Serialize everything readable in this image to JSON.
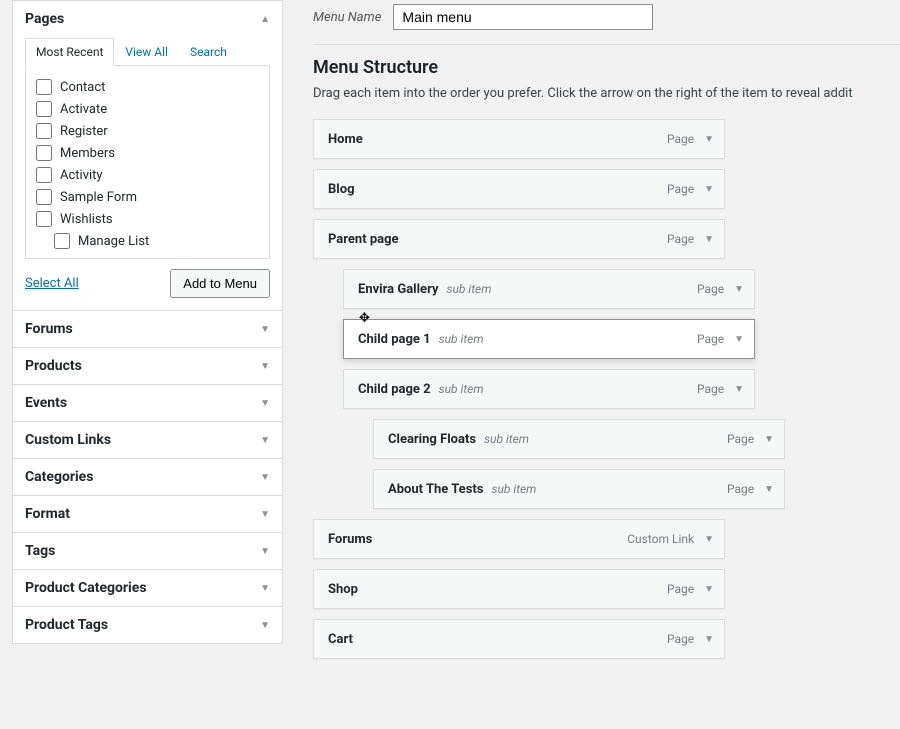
{
  "menuNameLabel": "Menu Name",
  "menuNameValue": "Main menu",
  "structureHeading": "Menu Structure",
  "structureHelp": "Drag each item into the order you prefer. Click the arrow on the right of the item to reveal addit",
  "subItemLabel": "sub item",
  "selectAll": "Select All",
  "addToMenu": "Add to Menu",
  "sidebar": {
    "pagesTitle": "Pages",
    "tabs": {
      "recent": "Most Recent",
      "viewAll": "View All",
      "search": "Search"
    },
    "pageList": [
      {
        "label": "Contact",
        "indent": false
      },
      {
        "label": "Activate",
        "indent": false
      },
      {
        "label": "Register",
        "indent": false
      },
      {
        "label": "Members",
        "indent": false
      },
      {
        "label": "Activity",
        "indent": false
      },
      {
        "label": "Sample Form",
        "indent": false
      },
      {
        "label": "Wishlists",
        "indent": false
      },
      {
        "label": "Manage List",
        "indent": true
      }
    ],
    "collapsedBoxes": [
      "Forums",
      "Products",
      "Events",
      "Custom Links",
      "Categories",
      "Format",
      "Tags",
      "Product Categories",
      "Product Tags"
    ]
  },
  "menuItems": [
    {
      "title": "Home",
      "type": "Page",
      "indent": 0,
      "sub": false,
      "drag": false
    },
    {
      "title": "Blog",
      "type": "Page",
      "indent": 0,
      "sub": false,
      "drag": false
    },
    {
      "title": "Parent page",
      "type": "Page",
      "indent": 0,
      "sub": false,
      "drag": false
    },
    {
      "title": "Envira Gallery",
      "type": "Page",
      "indent": 1,
      "sub": true,
      "drag": false
    },
    {
      "title": "Child page 1",
      "type": "Page",
      "indent": 1,
      "sub": true,
      "drag": true
    },
    {
      "title": "Child page 2",
      "type": "Page",
      "indent": 1,
      "sub": true,
      "drag": false
    },
    {
      "title": "Clearing Floats",
      "type": "Page",
      "indent": 2,
      "sub": true,
      "drag": false
    },
    {
      "title": "About The Tests",
      "type": "Page",
      "indent": 2,
      "sub": true,
      "drag": false
    },
    {
      "title": "Forums",
      "type": "Custom Link",
      "indent": 0,
      "sub": false,
      "drag": false
    },
    {
      "title": "Shop",
      "type": "Page",
      "indent": 0,
      "sub": false,
      "drag": false
    },
    {
      "title": "Cart",
      "type": "Page",
      "indent": 0,
      "sub": false,
      "drag": false
    }
  ]
}
